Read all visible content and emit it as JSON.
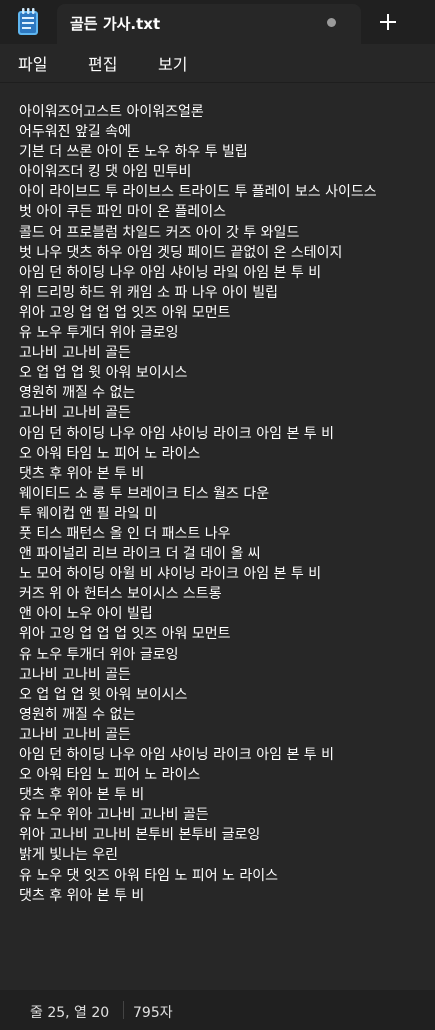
{
  "tab": {
    "title": "골든 가사.txt"
  },
  "menu": {
    "items": [
      "파일",
      "편집",
      "보기"
    ]
  },
  "editor": {
    "lines": [
      "아이워즈어고스트 아이워즈얼론",
      "어두워진 앞길 속에",
      "기븐 더 쓰론 아이 돈 노우 하우 투 빌립",
      "아이워즈더 킹 댓 아임 민투비",
      "아이 라이브드 투 라이브스 트라이드 투 플레이 보스 사이드스",
      "벗 아이 쿠든 파인 마이 온 플레이스",
      "콜드 어 프로블럼 차일드 커즈 아이 갓 투 와일드",
      "벗 나우 댓츠 하우 아임 겟딩 페이드 끝없이 온 스테이지",
      "아임 던 하이딩 나우 아임 샤이닝 라잌 아임 본 투 비",
      "위 드리밍 하드 위 캐임 소 파 나우 아이 빌립",
      "위아 고잉 업 업 업 잇즈 아워 모먼트",
      "유 노우 투게더 위아 글로잉",
      "고나비 고나비 골든",
      "오 업 업 업 윗 아워 보이시스",
      "영원히 깨질 수 없는",
      "고나비 고나비 골든",
      "아임 던 하이딩 나우 아임 샤이닝 라이크 아임 본 투 비",
      "오 아워 타임 노 피어 노 라이스",
      "댓츠 후 위아 본 투 비",
      "웨이티드 소 롱 투 브레이크 티스 월즈 다운",
      "투 웨이컵 앤 필 라잌 미",
      "풋 티스 패턴스 올 인 더 패스트 나우",
      "앤 파이널리 리브 라이크 더 걸 데이 올 씨",
      "노 모어 하이딩 아윌 비 샤이닝 라이크 아임 본 투 비",
      "커즈 위 아 헌터스 보이시스 스트롱",
      "앤 아이 노우 아이 빌립",
      "위아 고잉 업 업 업 잇즈 아워 모먼트",
      "유 노우 투개더 위아 글로잉",
      "고나비 고나비 골든",
      "오 업 업 업 윗 아워 보이시스",
      "영원히 깨질 수 없는",
      "고나비 고나비 골든",
      "아임 던 하이딩 나우 아임 샤이닝 라이크 아임 본 투 비",
      "오 아워 타임 노 피어 노 라이스",
      "댓츠 후 위아 본 투 비",
      "유 노우 위아 고나비 고나비 골든",
      "위아 고나비 고나비 본투비 본투비 글로잉",
      "밝게 빛나는 우린",
      "유 노우 댓 잇즈 아워 타임 노 피어 노 라이스",
      "댓츠 후 위아 본 투 비"
    ]
  },
  "status": {
    "position": "줄 25, 열 20",
    "char_count": "795자"
  },
  "icons": {
    "app": "notepad-icon",
    "modified": "unsaved-dot-icon",
    "new_tab": "plus-icon"
  },
  "colors": {
    "background": "#272727",
    "tabbar": "#202020",
    "text": "#ffffff",
    "icon_blue": "#5fb6f0"
  }
}
